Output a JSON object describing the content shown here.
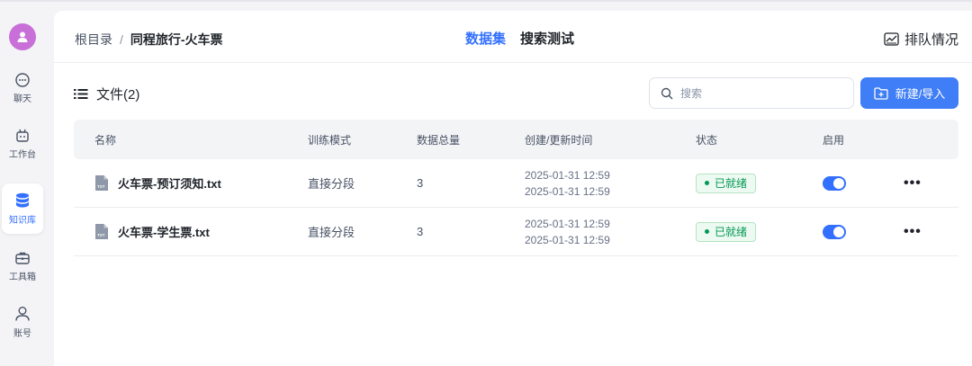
{
  "sidebar": {
    "items": [
      {
        "label": "聊天",
        "icon": "chat-icon"
      },
      {
        "label": "工作台",
        "icon": "robot-icon"
      },
      {
        "label": "知识库",
        "icon": "database-icon",
        "active": true
      },
      {
        "label": "工具箱",
        "icon": "toolbox-icon"
      },
      {
        "label": "账号",
        "icon": "user-icon"
      }
    ]
  },
  "header": {
    "breadcrumb_root": "根目录",
    "breadcrumb_sep": "/",
    "breadcrumb_current": "同程旅行-火车票",
    "tabs": [
      {
        "label": "数据集",
        "active": true
      },
      {
        "label": "搜索测试",
        "active": false
      }
    ],
    "queue_label": "排队情况"
  },
  "toolbar": {
    "files_title": "文件(2)",
    "search_placeholder": "搜索",
    "new_button": "新建/导入"
  },
  "table": {
    "columns": [
      "名称",
      "训练模式",
      "数据总量",
      "创建/更新时间",
      "状态",
      "启用"
    ],
    "rows": [
      {
        "name": "火车票-预订须知.txt",
        "mode": "直接分段",
        "count": "3",
        "created": "2025-01-31 12:59",
        "updated": "2025-01-31 12:59",
        "status": "已就绪",
        "enabled": true,
        "more": "•••"
      },
      {
        "name": "火车票-学生票.txt",
        "mode": "直接分段",
        "count": "3",
        "created": "2025-01-31 12:59",
        "updated": "2025-01-31 12:59",
        "status": "已就绪",
        "enabled": true,
        "more": "•••"
      }
    ]
  },
  "colors": {
    "accent": "#3370ff",
    "avatar": "#c86fd8",
    "status_green": "#039855"
  }
}
